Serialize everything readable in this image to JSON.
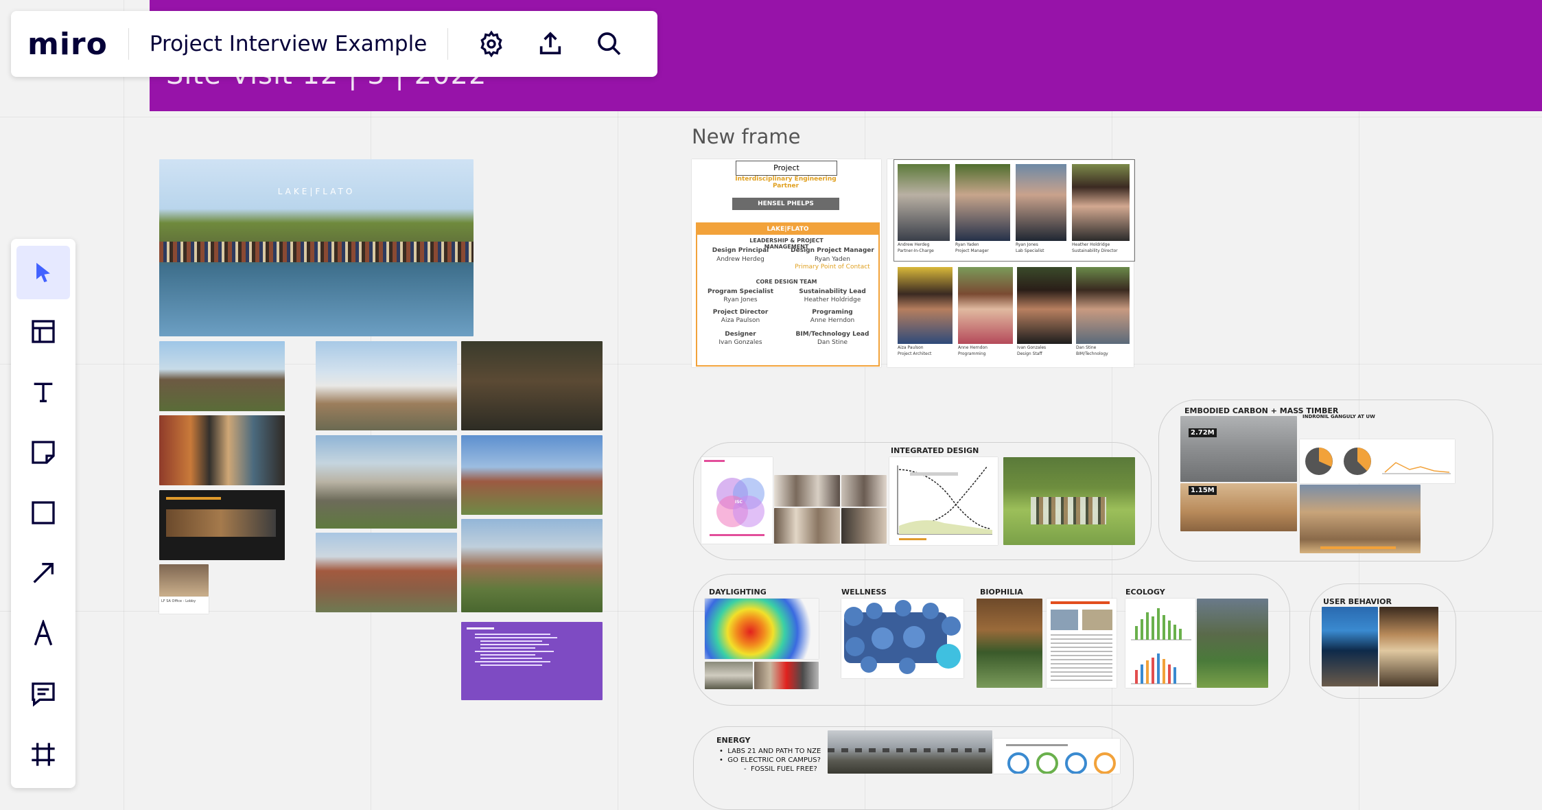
{
  "header": {
    "logo": "miro",
    "board_name": "Project Interview Example",
    "banner_title": "Site Visit 12 | 3 | 2022",
    "icons": [
      "settings-icon",
      "export-icon",
      "search-icon"
    ]
  },
  "toolbar": {
    "tools": [
      {
        "name": "select-tool",
        "icon": "cursor-icon",
        "active": true
      },
      {
        "name": "templates-tool",
        "icon": "layout-icon"
      },
      {
        "name": "text-tool",
        "icon": "text-icon"
      },
      {
        "name": "sticky-note-tool",
        "icon": "sticky-note-icon"
      },
      {
        "name": "shape-tool",
        "icon": "square-icon"
      },
      {
        "name": "line-tool",
        "icon": "arrow-icon"
      },
      {
        "name": "pen-tool",
        "icon": "pen-icon"
      },
      {
        "name": "comment-tool",
        "icon": "comment-icon"
      },
      {
        "name": "frame-tool",
        "icon": "frame-icon"
      }
    ]
  },
  "canvas": {
    "frame_label": "New frame",
    "hero_logo": "LAKE|FLATO",
    "org_chart": {
      "project": "Project",
      "firm_line": "Interdisciplinary Engineering Partner",
      "contractor": "HENSEL PHELPS",
      "architect": "LAKE|FLATO",
      "lead_heading": "LEADERSHIP & PROJECT MANAGEMENT",
      "design_principal_role": "Design Principal",
      "design_principal_name": "Andrew Herdeg",
      "dpm_role": "Design Project Manager",
      "dpm_name": "Ryan Yaden",
      "dpm_sub": "Primary Point of Contact",
      "core_heading": "CORE DESIGN TEAM",
      "program_role": "Program Specialist",
      "program_name": "Ryan Jones",
      "sustain_role": "Sustainability Lead",
      "sustain_name": "Heather Holdridge",
      "director_role": "Project Director",
      "director_name": "Aiza Paulson",
      "programing_role": "Programing",
      "programing_name": "Anne Herndon",
      "designer_role": "Designer",
      "designer_name": "Ivan Gonzales",
      "bim_role": "BIM/Technology Lead",
      "bim_name": "Dan Stine"
    },
    "team": [
      {
        "name": "Andrew Herdeg",
        "title": "Partner-In-Charge"
      },
      {
        "name": "Ryan Yaden",
        "title": "Project Manager"
      },
      {
        "name": "Ryan Jones",
        "title": "Lab Specialist"
      },
      {
        "name": "Heather Holdridge",
        "title": "Sustainability Director"
      },
      {
        "name": "Aiza Paulson",
        "title": "Project Architect"
      },
      {
        "name": "Anne Herndon",
        "title": "Programming"
      },
      {
        "name": "Ivan Gonzales",
        "title": "Design Staff"
      },
      {
        "name": "Dan Stine",
        "title": "BIM/Technology"
      }
    ],
    "sections": {
      "integrated_design": "INTEGRATED DESIGN",
      "embodied_carbon": "EMBODIED CARBON + MASS TIMBER",
      "indronil": "INDRONIL GANGULY AT UW",
      "daylighting": "DAYLIGHTING",
      "wellness": "WELLNESS",
      "biophilia": "BIOPHILIA",
      "ecology": "ECOLOGY",
      "user_behavior": "USER BEHAVIOR",
      "energy": "ENERGY",
      "carbon_a": "2.72M",
      "carbon_b": "1.15M",
      "isc": "ISC"
    },
    "energy_items": [
      "LABS 21 AND PATH TO NZE",
      "GO ELECTRIC OR CAMPUS?",
      "FOSSIL FUEL FREE?"
    ],
    "lobby_caption": "LF SA Office - Lobby"
  }
}
